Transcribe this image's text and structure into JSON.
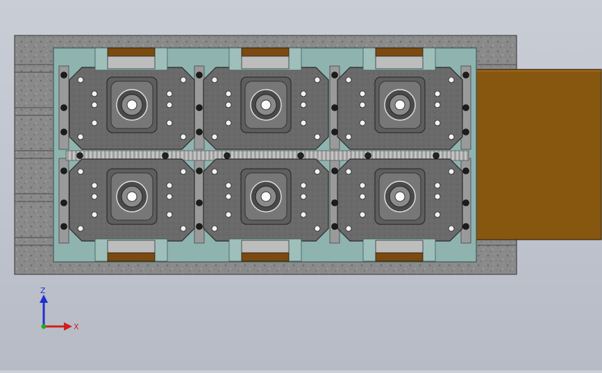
{
  "viewport": {
    "background_top": "#c9cdd6",
    "background_bottom": "#b6bbc6"
  },
  "colors": {
    "concrete": "#8c8c8c",
    "concrete_dark": "#6f6f6f",
    "base_plate": "#8fb4b0",
    "base_plate_edge": "#3e5a58",
    "motor_plate": "#6d6d6d",
    "motor_plate_edge": "#2a2a2a",
    "rail": "#9a9a9a",
    "bronze_plate": "#8a5a14",
    "bronze_plate_edge": "#3a2606",
    "clamp_gray": "#bdbdbd",
    "clamp_brown": "#7a4a10",
    "rack": "#b8b8b8"
  },
  "assembly": {
    "modules_rows": 2,
    "modules_cols": 3
  },
  "triad": {
    "z_label": "Z",
    "x_label": "X",
    "z_color": "#1f2fd0",
    "x_color": "#d01f1f",
    "origin_color": "#2aa52a"
  }
}
